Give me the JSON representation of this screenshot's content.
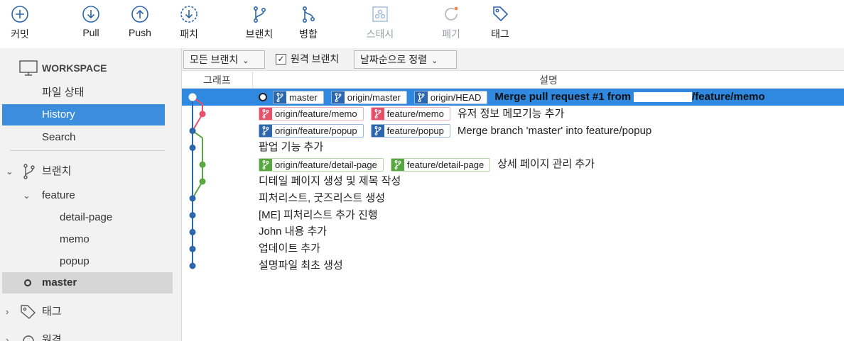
{
  "toolbar": {
    "commit": "커밋",
    "pull": "Pull",
    "push": "Push",
    "patch": "패치",
    "branch": "브랜치",
    "merge": "병합",
    "stash": "스태시",
    "discard": "폐기",
    "tag": "태그"
  },
  "sidebar": {
    "workspace": "WORKSPACE",
    "file_status": "파일 상태",
    "history": "History",
    "search": "Search",
    "branches": "브랜치",
    "feature_folder": "feature",
    "feature_branches": [
      "detail-page",
      "memo",
      "popup"
    ],
    "master": "master",
    "tags": "태그",
    "remote_partial": "원격"
  },
  "filter": {
    "branches_dropdown": "모든 브랜치",
    "remote_checkbox_label": "원격 브랜치",
    "remote_checked": true,
    "sort_dropdown": "날짜순으로 정렬"
  },
  "columns": {
    "graph": "그래프",
    "description": "설명"
  },
  "commits": [
    {
      "refs": [
        {
          "name": "master",
          "color": "blue"
        },
        {
          "name": "origin/master",
          "color": "blue"
        },
        {
          "name": "origin/HEAD",
          "color": "blue"
        }
      ],
      "head": true,
      "message_pre": "Merge pull request #1 from",
      "message_post": "/feature/memo"
    },
    {
      "refs": [
        {
          "name": "origin/feature/memo",
          "color": "red"
        },
        {
          "name": "feature/memo",
          "color": "red"
        }
      ],
      "message": "유저 정보 메모기능 추가"
    },
    {
      "refs": [
        {
          "name": "origin/feature/popup",
          "color": "blue"
        },
        {
          "name": "feature/popup",
          "color": "blue"
        }
      ],
      "message": "Merge branch 'master' into feature/popup"
    },
    {
      "refs": [],
      "message": "팝업 기능 추가"
    },
    {
      "refs": [
        {
          "name": "origin/feature/detail-page",
          "color": "green"
        },
        {
          "name": "feature/detail-page",
          "color": "green"
        }
      ],
      "message": "상세 페이지 관리 추가"
    },
    {
      "refs": [],
      "message": "디테일 페이지 생성 및 제목 작성"
    },
    {
      "refs": [],
      "message": "피처리스트, 굿즈리스트 생성"
    },
    {
      "refs": [],
      "message": "[ME] 피처리스트 추가 진행"
    },
    {
      "refs": [],
      "message": "John 내용 추가"
    },
    {
      "refs": [],
      "message": "업데이트 추가"
    },
    {
      "refs": [],
      "message": "설명파일 최초 생성"
    }
  ],
  "colors": {
    "selection": "#2f89e1",
    "sidebar_selection": "#3c8ddc",
    "lane_blue": "#2c66ad",
    "lane_red": "#e5516a",
    "lane_green": "#58a63f"
  }
}
